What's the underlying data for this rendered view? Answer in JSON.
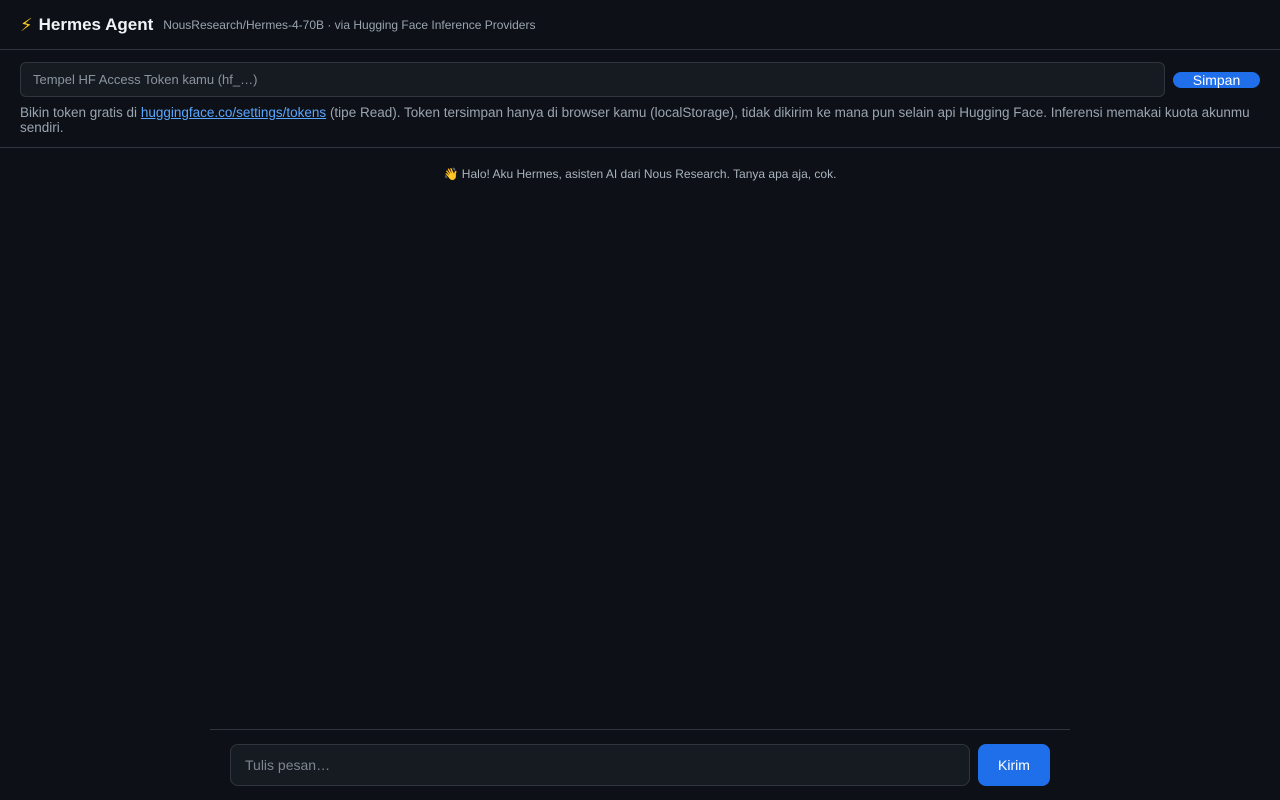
{
  "header": {
    "icon": "lightning-bolt-icon",
    "icon_glyph": "⚡",
    "title": "Hermes Agent",
    "subtitle": "NousResearch/Hermes-4-70B · via Hugging Face Inference Providers"
  },
  "token": {
    "placeholder": "Tempel HF Access Token kamu (hf_…)",
    "value": "",
    "save_label": "Simpan",
    "help_before": "Bikin token gratis di ",
    "help_link": "huggingface.co/settings/tokens",
    "help_after": " (tipe Read). Token tersimpan hanya di browser kamu (localStorage), tidak dikirim ke mana pun selain api Hugging Face. Inferensi memakai kuota akunmu sendiri."
  },
  "chat": {
    "greeting": "👋 Halo! Aku Hermes, asisten AI dari Nous Research. Tanya apa aja, cok."
  },
  "composer": {
    "placeholder": "Tulis pesan…",
    "value": "",
    "send_label": "Kirim"
  },
  "colors": {
    "background": "#0d1017",
    "accent": "#1f6feb",
    "link": "#58a6ff",
    "border": "#30363d"
  }
}
